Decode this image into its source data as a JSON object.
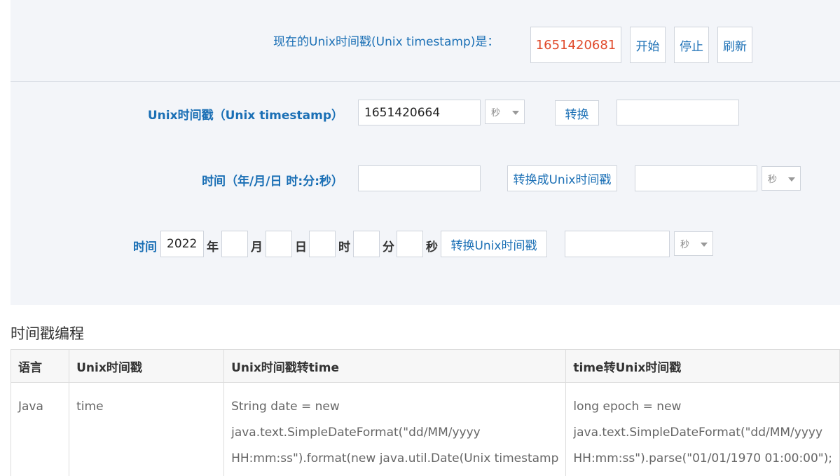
{
  "now": {
    "label": "现在的Unix时间戳(Unix timestamp)是：",
    "value": "1651420681",
    "start_label": "开始",
    "stop_label": "停止",
    "refresh_label": "刷新"
  },
  "row1": {
    "label": "Unix时间戳（Unix timestamp）",
    "input_value": "1651420664",
    "unit_select": "秒",
    "convert_label": "转换",
    "result_value": ""
  },
  "row2": {
    "label": "时间（年/月/日 时:分:秒）",
    "input_value": "",
    "convert_label": "转换成Unix时间戳",
    "result_value": "",
    "unit_select": "秒"
  },
  "row3": {
    "label": "时间",
    "year_value": "2022",
    "year_unit": "年",
    "month_value": "",
    "month_unit": "月",
    "day_value": "",
    "day_unit": "日",
    "hour_value": "",
    "hour_unit": "时",
    "minute_value": "",
    "minute_unit": "分",
    "second_value": "",
    "second_unit": "秒",
    "convert_label": "转换Unix时间戳",
    "result_value": "",
    "unit_select": "秒"
  },
  "programming": {
    "title": "时间戳编程",
    "headers": [
      "语言",
      "Unix时间戳",
      "Unix时间戳转time",
      "time转Unix时间戳"
    ],
    "rows": [
      {
        "language": "Java",
        "timestamp": "time",
        "to_time": [
          "String date = new",
          "java.text.SimpleDateFormat(\"dd/MM/yyyy",
          "HH:mm:ss\").format(new java.util.Date(Unix timestamp"
        ],
        "to_unix": [
          "long epoch = new",
          "java.text.SimpleDateFormat(\"dd/MM/yyyy",
          "HH:mm:ss\").parse(\"01/01/1970 01:00:00\");"
        ]
      }
    ]
  },
  "colors": {
    "panel_bg": "#f3f5f9",
    "accent_blue": "#1a6fb5",
    "timestamp_red": "#e0492a"
  }
}
